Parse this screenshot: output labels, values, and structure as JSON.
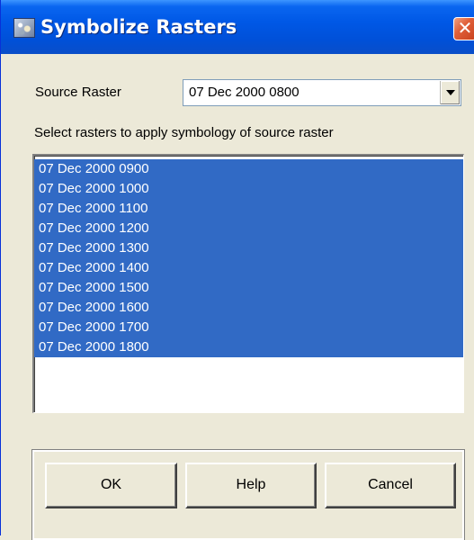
{
  "window": {
    "title": "Symbolize Rasters",
    "close_glyph": "✕"
  },
  "source": {
    "label": "Source Raster",
    "selected": "07 Dec 2000 0800"
  },
  "instruction": "Select rasters to apply symbology of source raster",
  "rasters": [
    "07 Dec 2000 0900",
    "07 Dec 2000 1000",
    "07 Dec 2000 1100",
    "07 Dec 2000 1200",
    "07 Dec 2000 1300",
    "07 Dec 2000 1400",
    "07 Dec 2000 1500",
    "07 Dec 2000 1600",
    "07 Dec 2000 1700",
    "07 Dec 2000 1800"
  ],
  "buttons": {
    "ok": "OK",
    "help": "Help",
    "cancel": "Cancel"
  },
  "colors": {
    "selection": "#316ac5",
    "titlebar": "#0058e6",
    "dialog_bg": "#ece9d8"
  }
}
